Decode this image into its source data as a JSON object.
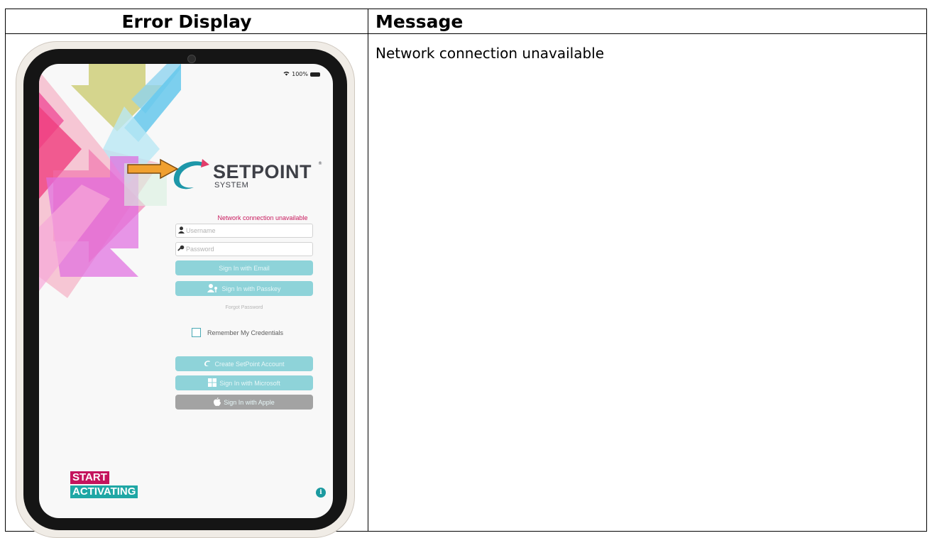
{
  "table": {
    "col1_header": "Error Display",
    "col2_header": "Message",
    "message": "Network connection unavailable"
  },
  "device": {
    "status_battery": "100%",
    "logo": {
      "name": "SETPOINT",
      "sub": "SYSTEM",
      "reg": "®"
    },
    "error_text": "Network connection unavailable",
    "username_placeholder": "Username",
    "password_placeholder": "Password",
    "sign_in_email": "Sign In with Email",
    "sign_in_passkey": "Sign In with Passkey",
    "forgot_password": "Forgot Password",
    "remember_credentials": "Remember My Credentials",
    "create_account": "Create SetPoint Account",
    "sign_in_microsoft": "Sign In with Microsoft",
    "sign_in_apple": "Sign In with Apple",
    "tag_start": "START",
    "tag_activating": "ACTIVATING",
    "info_glyph": "i"
  },
  "icons": [
    "wifi-icon",
    "battery-icon",
    "user-icon",
    "key-icon",
    "passkey-icon",
    "setpoint-swirl-icon",
    "microsoft-icon",
    "apple-icon",
    "info-icon",
    "pointer-arrow-icon"
  ],
  "colors": {
    "error": "#c8195d",
    "teal_button": "#8ed3d9",
    "gray_button": "#a3a3a3",
    "start_tag": "#c4145d",
    "activating_tag": "#1fa7a5",
    "arrow": "#f0a030"
  }
}
